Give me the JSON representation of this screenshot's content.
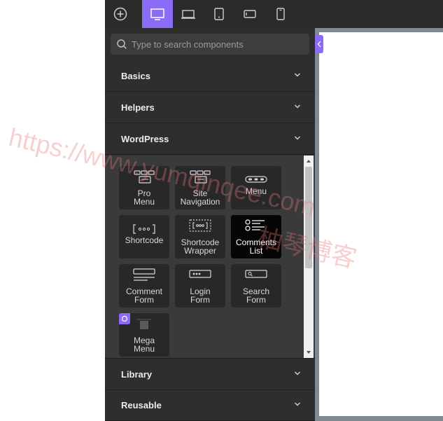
{
  "toolbar": {
    "add_icon": "plus-circle-icon",
    "devices": [
      {
        "name": "desktop-icon",
        "active": true
      },
      {
        "name": "laptop-icon",
        "active": false
      },
      {
        "name": "tablet-icon",
        "active": false
      },
      {
        "name": "mobile-landscape-icon",
        "active": false
      },
      {
        "name": "mobile-icon",
        "active": false
      }
    ]
  },
  "search": {
    "placeholder": "Type to search components"
  },
  "sections": {
    "basics": "Basics",
    "helpers": "Helpers",
    "wordpress": "WordPress",
    "library": "Library",
    "reusable": "Reusable"
  },
  "components": [
    {
      "label": "Pro\nMenu"
    },
    {
      "label": "Site\nNavigation"
    },
    {
      "label": "Menu"
    },
    {
      "label": "Shortcode"
    },
    {
      "label": "Shortcode\nWrapper"
    },
    {
      "label": "Comments\nList"
    },
    {
      "label": "Comment\nForm"
    },
    {
      "label": "Login\nForm"
    },
    {
      "label": "Search\nForm"
    },
    {
      "label": "Mega\nMenu"
    }
  ],
  "watermark": {
    "line1": "https://www.yumqinqee.com",
    "line2": "柚琴博客"
  },
  "colors": {
    "accent": "#8b6cf6",
    "panel": "#2e2e2e",
    "toolbar": "#2b2b2b"
  }
}
